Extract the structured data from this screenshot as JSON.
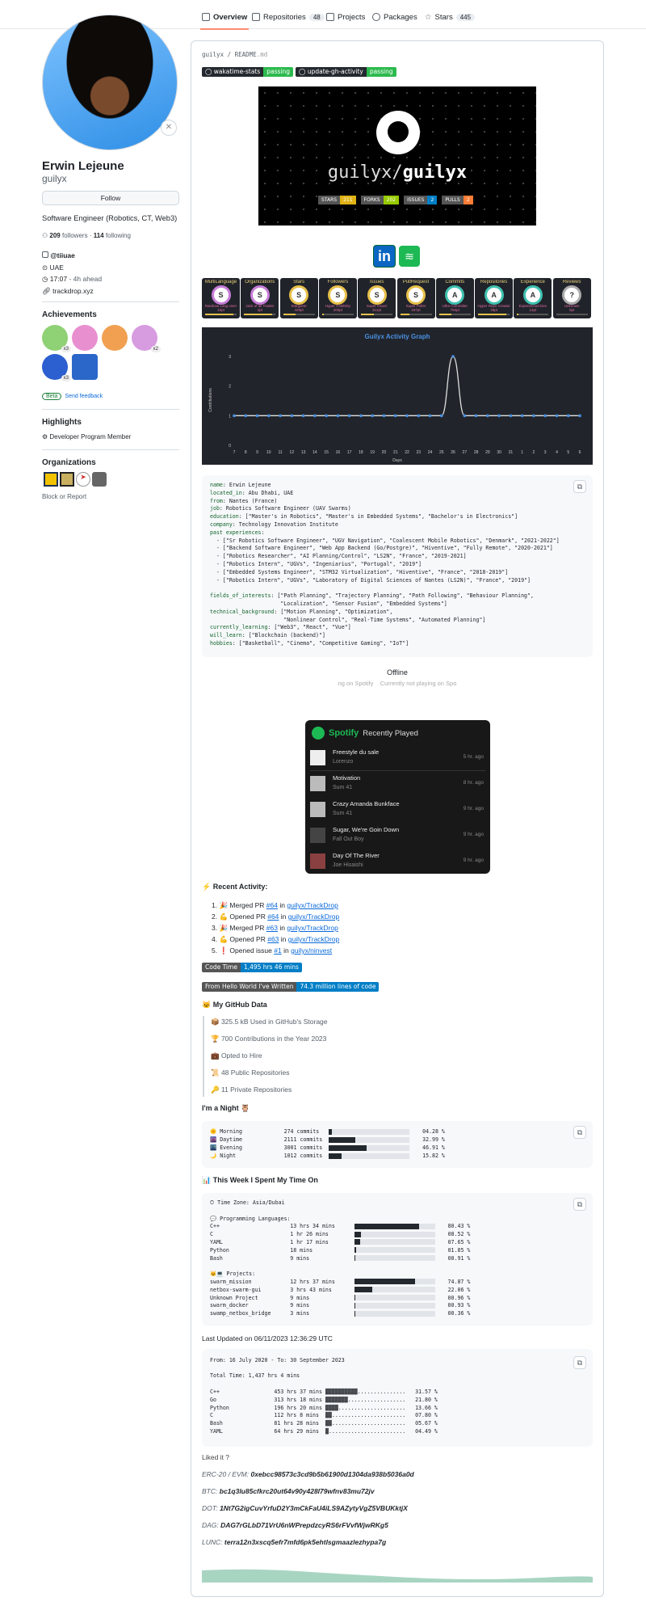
{
  "tabs": [
    {
      "label": "Overview",
      "icon": "book-icon"
    },
    {
      "label": "Repositories",
      "count": "48",
      "icon": "repo-icon"
    },
    {
      "label": "Projects",
      "icon": "table-icon"
    },
    {
      "label": "Packages",
      "icon": "package-icon"
    },
    {
      "label": "Stars",
      "count": "445",
      "icon": "star-icon"
    }
  ],
  "profile": {
    "name": "Erwin Lejeune",
    "username": "guilyx",
    "follow": "Follow",
    "bio": "Software Engineer (Robotics, CT, Web3)",
    "followers": "209",
    "followers_label": "followers",
    "following": "114",
    "following_label": "following",
    "org": "@tiiuae",
    "location": "UAE",
    "time": "17:07",
    "time_ahead": "- 4h ahead",
    "website": "trackdrop.xyz"
  },
  "achievements": {
    "title": "Achievements",
    "badges": [
      {
        "name": "Pull Shark",
        "count": "x3",
        "color": "#8fd175"
      },
      {
        "name": "YOLO",
        "count": "",
        "color": "#e88fd0"
      },
      {
        "name": "Starstruck",
        "count": "",
        "color": "#f0a050"
      },
      {
        "name": "Galaxy Brain",
        "count": "x2",
        "color": "#d79be0"
      },
      {
        "name": "Pair Extraordinaire",
        "count": "x3",
        "color": "#2c5fd0"
      },
      {
        "name": "Arctic Code Vault",
        "count": "",
        "color": "#2a67c9"
      }
    ],
    "beta": "Beta",
    "feedback": "Send feedback"
  },
  "highlights": {
    "title": "Highlights",
    "item": "Developer Program Member"
  },
  "organizations": {
    "title": "Organizations",
    "block": "Block or Report"
  },
  "readme": {
    "path_user": "guilyx",
    "path_sep": "/",
    "path_file": "README",
    "path_ext": ".md",
    "badges": [
      {
        "label": "wakatime-stats",
        "status": "passing"
      },
      {
        "label": "update-gh-activity",
        "status": "passing"
      }
    ],
    "banner": {
      "title_light": "guilyx/",
      "title_bold": "guilyx",
      "stats": [
        {
          "label": "STARS",
          "value": "211",
          "color": "#dfb317"
        },
        {
          "label": "FORKS",
          "value": "202",
          "color": "#97ca00"
        },
        {
          "label": "ISSUES",
          "value": "2",
          "color": "#007ec6"
        },
        {
          "label": "PULLS",
          "value": "2",
          "color": "#fe7d37"
        }
      ]
    },
    "socials": [
      "linkedin-icon",
      "spotify-icon"
    ],
    "trophies": [
      {
        "title": "MultiLanguage",
        "rank": "S",
        "sub": "Rainbow Lang User",
        "pt": "16pt",
        "color": "#c77dd8",
        "p": 0.9
      },
      {
        "title": "Organizations",
        "rank": "S",
        "sub": "Jack of all Trades",
        "pt": "4pt",
        "color": "#c77dd8",
        "p": 0.9
      },
      {
        "title": "Stars",
        "rank": "S",
        "sub": "Stargazer",
        "pt": "429pt",
        "color": "#e8c14a",
        "p": 0.4
      },
      {
        "title": "Followers",
        "rank": "S",
        "sub": "Hyper Celebrity",
        "pt": "200pt",
        "color": "#e8c14a",
        "p": 0.05
      },
      {
        "title": "Issues",
        "rank": "S",
        "sub": "Super Issuer",
        "pt": "312pt",
        "color": "#e8c14a",
        "p": 0.4
      },
      {
        "title": "PullRequest",
        "rank": "S",
        "sub": "Super Puller",
        "pt": "187pt",
        "color": "#e8c14a",
        "p": 0.3
      },
      {
        "title": "Commits",
        "rank": "A",
        "sub": "Ultra Committer",
        "pt": "793pt",
        "color": "#3fc1b0",
        "p": 0.4
      },
      {
        "title": "Repositories",
        "rank": "A",
        "sub": "Hyper Repo Creator",
        "pt": "46pt",
        "color": "#3fc1b0",
        "p": 0.9
      },
      {
        "title": "Experience",
        "rank": "A",
        "sub": "Experienced Dev",
        "pt": "14pt",
        "color": "#3fc1b0",
        "p": 0.05
      },
      {
        "title": "Reviews",
        "rank": "?",
        "sub": "Unknown",
        "pt": "0pt",
        "color": "#aaaaaa",
        "p": 0
      }
    ],
    "info_lines": [
      [
        [
          "key",
          "name"
        ],
        [
          "val",
          ": Erwin Lejeune"
        ]
      ],
      [
        [
          "key",
          "located_in"
        ],
        [
          "val",
          ": Abu Dhabi, UAE"
        ]
      ],
      [
        [
          "key",
          "from"
        ],
        [
          "val",
          ": Nantes (France)"
        ]
      ],
      [
        [
          "key",
          "job"
        ],
        [
          "val",
          ": Robotics Software Engineer (UAV Swarms)"
        ]
      ],
      [
        [
          "key",
          "education"
        ],
        [
          "val",
          ": [\"Master's in Robotics\", \"Master's in Embedded Systems\", \"Bachelor's in Electronics\"]"
        ]
      ],
      [
        [
          "key",
          "company"
        ],
        [
          "val",
          ": Technology Innovation Institute"
        ]
      ],
      [
        [
          "key",
          "past experiences"
        ],
        [
          "val",
          ":"
        ]
      ],
      [
        [
          "val",
          "  - [\"Sr Robotics Software Engineer\", \"UGV Navigation\", \"Coalescent Mobile Robotics\", \"Denmark\", \"2021-2022\"]"
        ]
      ],
      [
        [
          "val",
          "  - [\"Backend Software Engineer\", \"Web App Backend (Go/Postgre)\", \"Hiventive\", \"Fully Remote\", \"2020-2021\"]"
        ]
      ],
      [
        [
          "val",
          "  - [\"Robotics Researcher\", \"AI Planning/Control\", \"LS2N\", \"France\", \"2019-2021]"
        ]
      ],
      [
        [
          "val",
          "  - [\"Robotics Intern\", \"UGVs\", \"Ingeniarius\", \"Portugal\", \"2019\"]"
        ]
      ],
      [
        [
          "val",
          "  - [\"Embedded Systems Engineer\", \"STM32 Virtualization\", \"Hiventive\", \"France\", \"2018-2019\"]"
        ]
      ],
      [
        [
          "val",
          "  - [\"Robotics Intern\", \"UGVs\", \"Laboratory of Digital Sciences of Nantes (LS2N)\", \"France\", \"2019\"]"
        ]
      ],
      [
        [
          "val",
          ""
        ]
      ],
      [
        [
          "key",
          "fields_of_interests"
        ],
        [
          "val",
          ": [\"Path Planning\", \"Trajectory Planning\", \"Path Following\", \"Behaviour Planning\","
        ]
      ],
      [
        [
          "val",
          "                      \"Localization\", \"Sensor Fusion\", \"Embedded Systems\"]"
        ]
      ],
      [
        [
          "key",
          "technical_background"
        ],
        [
          "val",
          ": [\"Motion Planning\", \"Optimization\","
        ]
      ],
      [
        [
          "val",
          "                       \"Nonlinear Control\", \"Real-Time Systems\", \"Automated Planning\"]"
        ]
      ],
      [
        [
          "key",
          "currently_learning"
        ],
        [
          "val",
          ": [\"Web3\", \"React\", \"Vue\"]"
        ]
      ],
      [
        [
          "key",
          "will_learn"
        ],
        [
          "val",
          ": [\"Blockchain (backend)\"]"
        ]
      ],
      [
        [
          "key",
          "hobbies"
        ],
        [
          "val",
          ": [\"Basketball\", \"Cinema\", \"Competitive Gaming\", \"IoT\"]"
        ]
      ]
    ],
    "spotify_status": {
      "title": "Offline",
      "left": "ng on Spotify",
      "right": "Currently not playing on Spo"
    },
    "spotify": {
      "brand": "Spotify",
      "title": "Recently Played",
      "tracks": [
        {
          "name": "Freestyle du sale",
          "artist": "Lorenzo",
          "ago": "5 hr. ago"
        },
        {
          "name": "Motivation",
          "artist": "Sum 41",
          "ago": "8 hr. ago"
        },
        {
          "name": "Crazy Amanda Bunkface",
          "artist": "Sum 41",
          "ago": "9 hr. ago"
        },
        {
          "name": "Sugar, We're Goin Down",
          "artist": "Fall Out Boy",
          "ago": "9 hr. ago"
        },
        {
          "name": "Day Of The River",
          "artist": "Joe Hisaishi",
          "ago": "9 hr. ago"
        }
      ]
    },
    "recent_activity": {
      "title": "⚡ Recent Activity:",
      "items": [
        {
          "emoji": "🎉",
          "action": "Merged PR",
          "ref": "#64",
          "in": "in",
          "repo": "guilyx/TrackDrop"
        },
        {
          "emoji": "💪",
          "action": "Opened PR",
          "ref": "#64",
          "in": "in",
          "repo": "guilyx/TrackDrop"
        },
        {
          "emoji": "🎉",
          "action": "Merged PR",
          "ref": "#63",
          "in": "in",
          "repo": "guilyx/TrackDrop"
        },
        {
          "emoji": "💪",
          "action": "Opened PR",
          "ref": "#63",
          "in": "in",
          "repo": "guilyx/TrackDrop"
        },
        {
          "emoji": "❗",
          "action": "Opened issue",
          "ref": "#1",
          "in": "in",
          "repo": "guilyx/ninvest"
        }
      ]
    },
    "code_time": {
      "label": "Code Time",
      "value": "1,495 hrs 46 mins"
    },
    "lines": {
      "label": "From Hello World I've Written",
      "value": "74.3 million lines of code"
    },
    "github_data": {
      "title": "🐱 My GitHub Data",
      "items": [
        "📦 325.5 kB Used in GitHub's Storage",
        "🏆 700 Contributions in the Year 2023",
        "💼 Opted to Hire",
        "📜 48 Public Repositories",
        "🔑 11 Private Repositories"
      ]
    },
    "night": {
      "title": "I'm a Night 🦉",
      "rows": [
        {
          "icon": "🌞",
          "name": "Morning",
          "commits": "274 commits",
          "pct": "04.28 %",
          "p": 4.28
        },
        {
          "icon": "🌆",
          "name": "Daytime",
          "commits": "2111 commits",
          "pct": "32.99 %",
          "p": 32.99
        },
        {
          "icon": "🌃",
          "name": "Evening",
          "commits": "3001 commits",
          "pct": "46.91 %",
          "p": 46.91
        },
        {
          "icon": "🌙",
          "name": "Night",
          "commits": "1012 commits",
          "pct": "15.82 %",
          "p": 15.82
        }
      ]
    },
    "week": {
      "title": "📊 This Week I Spent My Time On",
      "timezone": "🕑︎ Time Zone: Asia/Dubai",
      "lang_title": "💬 Programming Languages:",
      "languages": [
        {
          "name": "C++",
          "time": "13 hrs 34 mins",
          "pct": "80.43 %",
          "p": 80.43
        },
        {
          "name": "C",
          "time": "1 hr 26 mins",
          "pct": "08.52 %",
          "p": 8.52
        },
        {
          "name": "YAML",
          "time": "1 hr 17 mins",
          "pct": "07.65 %",
          "p": 7.65
        },
        {
          "name": "Python",
          "time": "18 mins",
          "pct": "01.85 %",
          "p": 1.85
        },
        {
          "name": "Bash",
          "time": "9 mins",
          "pct": "00.91 %",
          "p": 0.91
        }
      ],
      "proj_title": "🐱‍💻 Projects:",
      "projects": [
        {
          "name": "swarm_mission",
          "time": "12 hrs 37 mins",
          "pct": "74.87 %",
          "p": 74.87
        },
        {
          "name": "netbox-swarm-gui",
          "time": "3 hrs 43 mins",
          "pct": "22.06 %",
          "p": 22.06
        },
        {
          "name": "Unknown Project",
          "time": "9 mins",
          "pct": "00.96 %",
          "p": 0.96
        },
        {
          "name": "swarm_docker",
          "time": "9 mins",
          "pct": "00.93 %",
          "p": 0.93
        },
        {
          "name": "swamp_netbox_bridge",
          "time": "3 mins",
          "pct": "00.36 %",
          "p": 0.36
        }
      ]
    },
    "last_updated": "Last Updated on 06/11/2023 12:36:29 UTC",
    "alltime": {
      "range": "From: 16 July 2020 - To: 30 September 2023",
      "total": "Total Time: 1,437 hrs 4 mins",
      "rows": [
        {
          "name": "C++",
          "time": "453 hrs 37 mins",
          "pct": "31.57 %",
          "p": 31.57
        },
        {
          "name": "Go",
          "time": "313 hrs 18 mins",
          "pct": "21.80 %",
          "p": 21.8
        },
        {
          "name": "Python",
          "time": "196 hrs 20 mins",
          "pct": "13.66 %",
          "p": 13.66
        },
        {
          "name": "C",
          "time": "112 hrs 8 mins",
          "pct": "07.80 %",
          "p": 7.8
        },
        {
          "name": "Bash",
          "time": "81 hrs 28 mins",
          "pct": "05.67 %",
          "p": 5.67
        },
        {
          "name": "YAML",
          "time": "64 hrs 29 mins",
          "pct": "04.49 %",
          "p": 4.49
        }
      ]
    },
    "liked": "Liked it ?",
    "crypto": [
      {
        "label": "ERC-20 / EVM:",
        "addr": "0xebcc98573c3cd9b5b61900d1304da938b5036a0d"
      },
      {
        "label": "BTC:",
        "addr": "bc1q3lu85cfkrc20ut64v90y428l79wfnv83mu72jv"
      },
      {
        "label": "DOT:",
        "addr": "1Nt7G2igCuvYrfuD2Y3mCkFaU4iLS9AZytyVgZ5VBUKktjX"
      },
      {
        "label": "DAG:",
        "addr": "DAG7rGLbD71VrU6nWPrepdzcyRS6rFVvfWjwRKg5"
      },
      {
        "label": "LUNC:",
        "addr": "terra12n3xscq5efr7mfd6pk5ehtlsgmaazlezhypa7g"
      }
    ]
  },
  "chart_data": {
    "type": "line",
    "title": "Guilyx Activity Graph",
    "xlabel": "Days",
    "ylabel": "Contributions",
    "categories": [
      "7",
      "8",
      "9",
      "10",
      "11",
      "12",
      "13",
      "14",
      "15",
      "16",
      "17",
      "18",
      "19",
      "20",
      "21",
      "22",
      "23",
      "24",
      "25",
      "26",
      "27",
      "28",
      "29",
      "30",
      "31",
      "1",
      "2",
      "3",
      "4",
      "5",
      "6"
    ],
    "values": [
      1,
      1,
      1,
      1,
      1,
      1,
      1,
      1,
      1,
      1,
      1,
      1,
      1,
      1,
      1,
      1,
      1,
      1,
      1,
      3,
      1,
      1,
      1,
      1,
      1,
      1,
      1,
      1,
      1,
      1,
      1
    ],
    "ylim": [
      0,
      3
    ],
    "yticks": [
      "0",
      "1",
      "2",
      "3"
    ],
    "grid": false,
    "colors": {
      "background": "#21252b",
      "line": "#e0e0e0",
      "point": "#4a90e2",
      "title": "#4a90e2"
    }
  }
}
